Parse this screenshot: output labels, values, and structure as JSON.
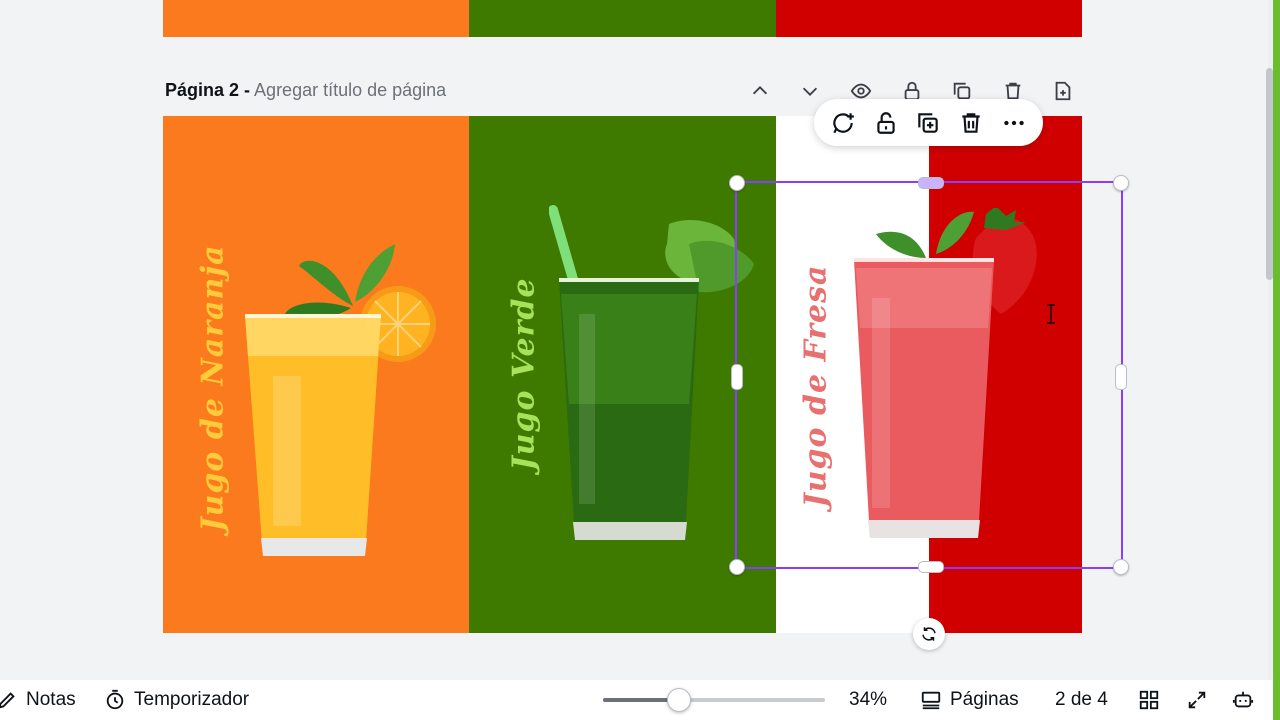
{
  "colors": {
    "orange": "#fb7a1d",
    "green": "#3f7a00",
    "red": "#d10000",
    "white": "#ffffff",
    "selection": "#8b3dff",
    "accent": "#6abd2c"
  },
  "page_header": {
    "page_label": "Página 2 -",
    "title_placeholder": "Agregar título de página",
    "controls": [
      "chevron-up-icon",
      "chevron-down-icon",
      "eye-icon",
      "lock-icon",
      "duplicate-icon",
      "trash-icon",
      "add-page-icon"
    ]
  },
  "design": {
    "panels": [
      {
        "label": "Jugo de Naranja",
        "label_color": "#ffcb3a",
        "bg": "#fb7a1d",
        "drink": "orange"
      },
      {
        "label": "Jugo Verde",
        "label_color": "#a6e35a",
        "bg": "#3f7a00",
        "drink": "green"
      },
      {
        "label": "Jugo de Fresa",
        "label_color": "#e8706e",
        "bg": "split",
        "drink": "strawberry"
      }
    ]
  },
  "float_toolbar": {
    "buttons": [
      "comment-add-icon",
      "lock-icon",
      "duplicate-icon",
      "trash-icon",
      "more-icon"
    ]
  },
  "bottom_bar": {
    "notes_label": "Notas",
    "timer_label": "Temporizador",
    "zoom_value": 0.34,
    "zoom_label": "34%",
    "pages_label": "Páginas",
    "page_count": "2 de 4"
  }
}
